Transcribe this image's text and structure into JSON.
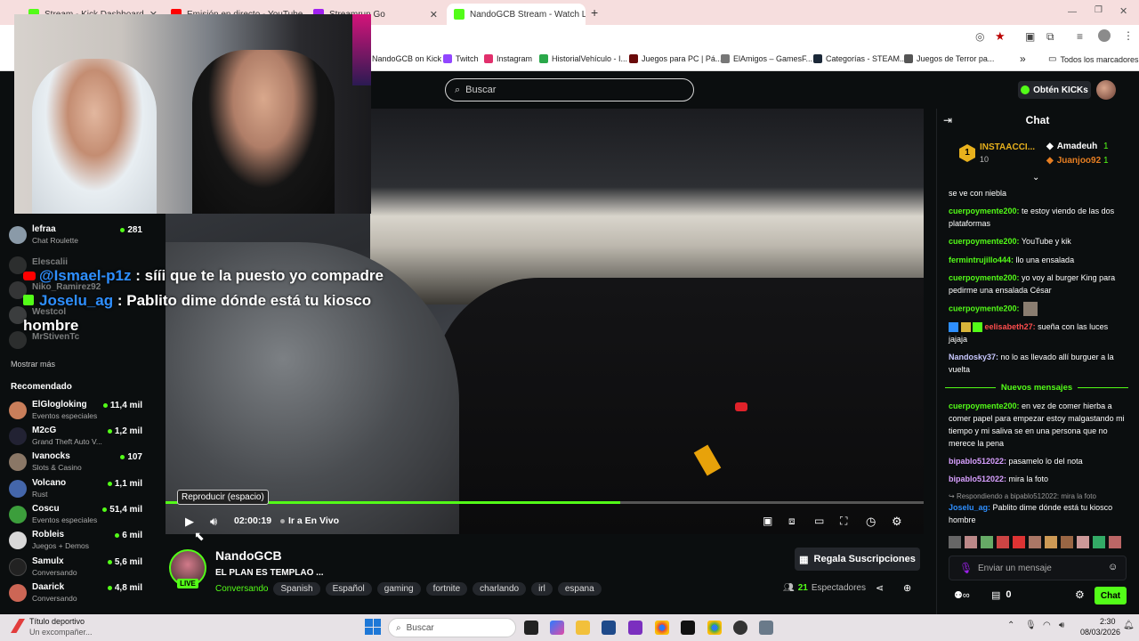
{
  "browser": {
    "tabs": [
      {
        "label": "Stream - Kick Dashboard",
        "color": "#53fc18"
      },
      {
        "label": "Emisión en directo - YouTube",
        "color": "#ff0000"
      },
      {
        "label": "Streamrun Go",
        "color": "#a020f0"
      },
      {
        "label": "NandoGCB Stream - Watch Live",
        "color": "#53fc18"
      }
    ],
    "new_tab": "+",
    "bookmarks": [
      "NandoGCB on Kick",
      "Twitch",
      "Instagram",
      "HistorialVehículo - I...",
      "Juegos para PC | Pá...",
      "ElAmigos – GamesF...",
      "Categorías - STEAM...",
      "Juegos de Terror pa..."
    ],
    "bookmarks_more": "»",
    "all_bookmarks": "Todos los marcadores"
  },
  "header": {
    "search_placeholder": "Buscar",
    "get_kicks": "Obtén KICKs"
  },
  "sidebar": {
    "followed": [
      {
        "name": "lefraa",
        "sub": "Chat Roulette",
        "count": "281",
        "color": "#8a9aa8"
      },
      {
        "name": "Elescalii",
        "sub": "",
        "count": "",
        "color": "#555"
      },
      {
        "name": "Niko_Ramirez92",
        "sub": "",
        "count": "",
        "color": "#666"
      },
      {
        "name": "Westcol",
        "sub": "",
        "count": "",
        "color": "#777"
      },
      {
        "name": "MrStivenTc",
        "sub": "",
        "count": "",
        "color": "#555"
      }
    ],
    "show_more": "Mostrar más",
    "recommended_title": "Recomendado",
    "recommended": [
      {
        "name": "ElGlogloking",
        "sub": "Eventos especiales",
        "count": "11,4 mil",
        "color": "#c97e5a"
      },
      {
        "name": "M2cG",
        "sub": "Grand Theft Auto V...",
        "count": "1,2 mil",
        "color": "#223"
      },
      {
        "name": "Ivanocks",
        "sub": "Slots & Casino",
        "count": "107",
        "color": "#8a7766"
      },
      {
        "name": "Volcano",
        "sub": "Rust",
        "count": "1,1 mil",
        "color": "#4466aa"
      },
      {
        "name": "Coscu",
        "sub": "Eventos especiales",
        "count": "51,4 mil",
        "color": "#3c9e3c"
      },
      {
        "name": "Robleis",
        "sub": "Juegos + Demos",
        "count": "6 mil",
        "color": "#d8d8d8"
      },
      {
        "name": "Samulx",
        "sub": "Conversando",
        "count": "5,6 mil",
        "color": "#222"
      },
      {
        "name": "Daarick",
        "sub": "Conversando",
        "count": "4,8 mil",
        "color": "#cc6655"
      }
    ]
  },
  "overlay_chat": [
    {
      "user": "@Ismael-p1z",
      "text": " : sííi que te la puesto yo compadre",
      "source": "youtube"
    },
    {
      "user": "Joselu_ag",
      "text": " : Pablito dime dónde está tu kiosco",
      "source": "kick"
    },
    {
      "user": "",
      "text": "hombre",
      "source": ""
    }
  ],
  "player": {
    "tooltip": "Reproducir (espacio)",
    "time": "02:00:19",
    "go_live": "Ir a En Vivo",
    "progress": 0.6
  },
  "channel": {
    "name": "NandoGCB",
    "live_badge": "LIVE",
    "title": "EL PLAN ES TEMPLAO ...",
    "category": "Conversando",
    "tags": [
      "Spanish",
      "Español",
      "gaming",
      "fortnite",
      "charlando",
      "irl",
      "espana"
    ],
    "gift_subs": "Regala Suscripciones",
    "viewers_count": "21",
    "viewers_label": "Espectadores"
  },
  "chat": {
    "title": "Chat",
    "leaderboard": {
      "rank": "1",
      "top_user": "INSTAACCI...",
      "top_count": "10",
      "others": [
        {
          "name": "Amadeuh",
          "count": "1"
        },
        {
          "name": "Juanjoo92",
          "count": "1"
        }
      ]
    },
    "messages": [
      {
        "user": "",
        "color": "#fff",
        "text": "se ve con niebla"
      },
      {
        "user": "cuerpoymente200:",
        "color": "#53fc18",
        "text": " te estoy viendo de las dos plataformas"
      },
      {
        "user": "cuerpoymente200:",
        "color": "#53fc18",
        "text": " YouTube y kik"
      },
      {
        "user": "fermintrujillo444:",
        "color": "#53fc18",
        "text": " llo una ensalada"
      },
      {
        "user": "cuerpoymente200:",
        "color": "#53fc18",
        "text": " yo voy al burger King para pedirme una ensalada César"
      },
      {
        "user": "cuerpoymente200:",
        "color": "#53fc18",
        "text": ""
      },
      {
        "user": "eelisabeth27:",
        "color": "#ff4d4d",
        "text": " sueña con las luces jajaja"
      },
      {
        "user": "Nandosky37:",
        "color": "#c8c8ff",
        "text": " no lo as llevado allí burguer a la vuelta"
      }
    ],
    "new_messages_label": "Nuevos mensajes",
    "new_messages": [
      {
        "user": "cuerpoymente200:",
        "color": "#53fc18",
        "text": " en vez de comer hierba a comer papel para empezar estoy malgastando mi tiempo y mi saliva se en una persona que no merece la pena"
      },
      {
        "user": "bipablo512022:",
        "color": "#d8a0ff",
        "text": " pasamelo lo del nota"
      },
      {
        "user": "bipablo512022:",
        "color": "#d8a0ff",
        "text": " mira la foto"
      }
    ],
    "reply_hint": "Respondiendo a bipablo512022: mira la foto",
    "reply_user": "Joselu_ag:",
    "reply_text": " Pablito dime dónde está tu kiosco hombre",
    "input_placeholder": "Enviar un mensaje",
    "points": "0",
    "chat_button": "Chat"
  },
  "taskbar": {
    "notif_title": "Título deportivo",
    "notif_sub": "Un excompañer...",
    "search": "Buscar",
    "time": "2:30",
    "date": "08/03/2026"
  }
}
